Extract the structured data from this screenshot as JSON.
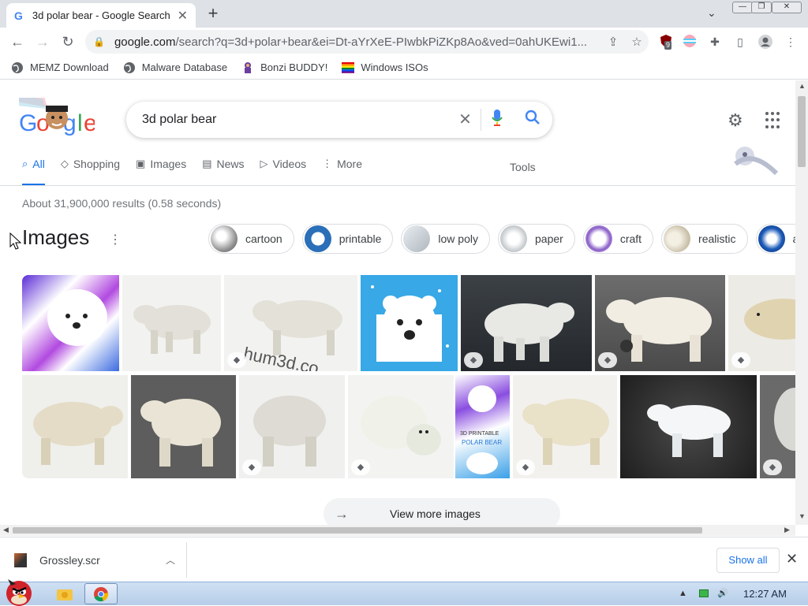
{
  "browser": {
    "tab_title": "3d polar bear - Google Search",
    "tab_favicon": "G",
    "url_host": "google.com",
    "url_rest": "/search?q=3d+polar+bear&ei=Dt-aYrXeE-PIwbkPiZKp8Ao&ved=0ahUKEwi1...",
    "extension_badge": "9"
  },
  "bookmarks": [
    {
      "label": "MEMZ Download",
      "icon": "globe-icon"
    },
    {
      "label": "Malware Database",
      "icon": "globe-icon"
    },
    {
      "label": "Bonzi BUDDY!",
      "icon": "bonzi-icon"
    },
    {
      "label": "Windows ISOs",
      "icon": "windows-flag-icon"
    }
  ],
  "search": {
    "query": "3d polar bear"
  },
  "nav_tabs": [
    {
      "label": "All",
      "icon": "⌕",
      "active": true
    },
    {
      "label": "Shopping",
      "icon": "◇",
      "active": false
    },
    {
      "label": "Images",
      "icon": "▣",
      "active": false
    },
    {
      "label": "News",
      "icon": "▤",
      "active": false
    },
    {
      "label": "Videos",
      "icon": "▷",
      "active": false
    },
    {
      "label": "More",
      "icon": "⋮",
      "active": false
    }
  ],
  "tools_label": "Tools",
  "result_stats": "About 31,900,000 results (0.58 seconds)",
  "images_section": {
    "heading": "Images",
    "chips": [
      "cartoon",
      "printable",
      "low poly",
      "paper",
      "craft",
      "realistic",
      "anima"
    ],
    "view_more": "View more images"
  },
  "downloads": {
    "file": "Grossley.scr",
    "show_all": "Show all"
  },
  "taskbar": {
    "clock": "12:27 AM"
  },
  "colors": {
    "accent": "#1a73e8",
    "chip_border": "#dadce0",
    "tab_bar": "#dee1e6"
  }
}
